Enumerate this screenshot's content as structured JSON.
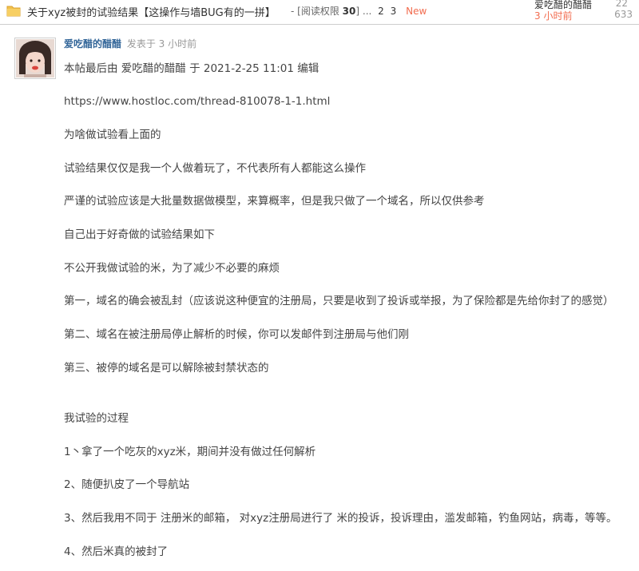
{
  "thread": {
    "title": "关于xyz被封的试验结果【这操作与墙BUG有的一拼】",
    "read_perm_label": "- [阅读权限",
    "read_perm_value": "30",
    "read_perm_close": "]",
    "pages_ellipsis": "...",
    "page_2": "2",
    "page_3": "3",
    "new_badge": "New",
    "last_poster": "爱吃醋的醋醋",
    "last_time": "3 小时前",
    "replies": "22",
    "views": "633"
  },
  "post": {
    "author": "爱吃醋的醋醋",
    "posted_at": "发表于 3 小时前",
    "edited_note": "本帖最后由 爱吃醋的醋醋 于 2021-2-25 11:01 编辑",
    "link": "https://www.hostloc.com/thread-810078-1-1.html",
    "paragraphs": [
      "为啥做试验看上面的",
      "试验结果仅仅是我一个人做着玩了，不代表所有人都能这么操作",
      "严谨的试验应该是大批量数据做模型，来算概率，但是我只做了一个域名，所以仅供参考",
      "自己出于好奇做的试验结果如下",
      "不公开我做试验的米，为了减少不必要的麻烦",
      "第一，域名的确会被乱封（应该说这种便宜的注册局，只要是收到了投诉或举报，为了保险都是先给你封了的感觉）",
      "第二、域名在被注册局停止解析的时候，你可以发邮件到注册局与他们刚",
      "第三、被停的域名是可以解除被封禁状态的",
      "我试验的过程",
      "1丶拿了一个吃灰的xyz米，期间并没有做过任何解析",
      "2、随便扒皮了一个导航站",
      "3、然后我用不同于 注册米的邮箱， 对xyz注册局进行了 米的投诉，投诉理由，滥发邮箱，钓鱼网站，病毒，等等。",
      "4、然后米真的被封了"
    ]
  },
  "icons": {
    "folder": "folder-icon",
    "avatar": "user-avatar"
  },
  "colors": {
    "author_link": "#336699",
    "new_badge": "#f26c4f",
    "folder": "#f2c14e"
  }
}
